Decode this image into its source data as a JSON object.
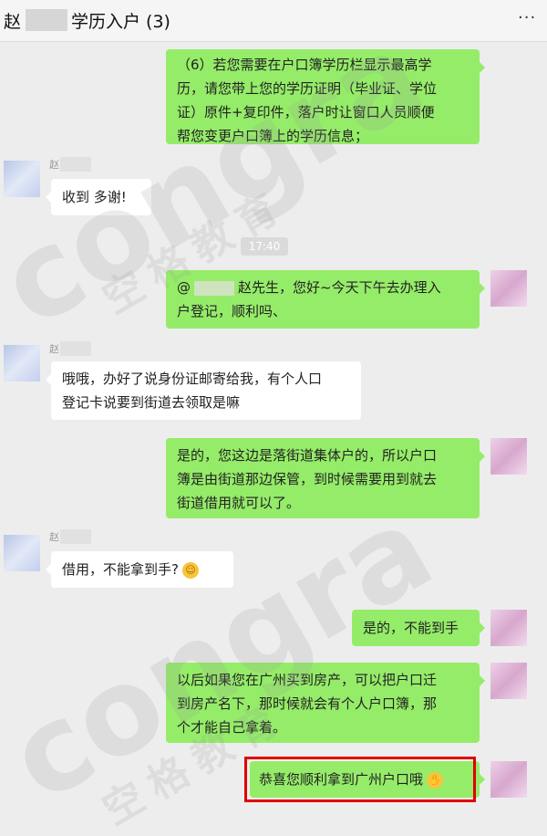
{
  "header": {
    "name_prefix": "赵",
    "title": "学历入户 (3)",
    "more": "···"
  },
  "timestamp": "17:40",
  "messages": [
    {
      "side": "right",
      "lines": [
        "（6）若您需要在户口簿学历栏显示最高学",
        "历，请您带上您的学历证明（毕业证、学位",
        "证）原件+复印件，落户时让窗口人员顺便",
        "帮您变更户口簿上的学历信息；"
      ]
    },
    {
      "side": "left",
      "sender": "赵",
      "lines": [
        "收到 多谢!"
      ]
    },
    {
      "side": "right",
      "prefix": "@",
      "lines": [
        "赵先生，您好~今天下午去办理入",
        "户登记，顺利吗、"
      ]
    },
    {
      "side": "left",
      "sender": "赵",
      "lines": [
        "哦哦，办好了说身份证邮寄给我，有个人口",
        "登记卡说要到街道去领取是嘛"
      ]
    },
    {
      "side": "right",
      "lines": [
        "是的，您这边是落街道集体户的，所以户口",
        "簿是由街道那边保管，到时候需要用到就去",
        "街道借用就可以了。"
      ]
    },
    {
      "side": "left",
      "sender": "赵",
      "lines": [
        "借用，不能拿到手?"
      ],
      "emoji": "crying-laughing-emoji"
    },
    {
      "side": "right",
      "lines": [
        "是的，不能到手"
      ]
    },
    {
      "side": "right",
      "lines": [
        "以后如果您在广州买到房产，可以把户口迁",
        "到房产名下，那时候就会有个人户口簿，那",
        "个才能自己拿着。"
      ]
    },
    {
      "side": "right",
      "lines": [
        "恭喜您顺利拿到广州户口哦"
      ],
      "emoji": "applause-emoji",
      "highlighted": true
    }
  ],
  "watermark": {
    "brand": "congra",
    "cn": "空格教育"
  },
  "colors": {
    "self_bubble": "#95ec69",
    "other_bubble": "#ffffff",
    "background": "#ededed",
    "highlight": "#e00000"
  }
}
